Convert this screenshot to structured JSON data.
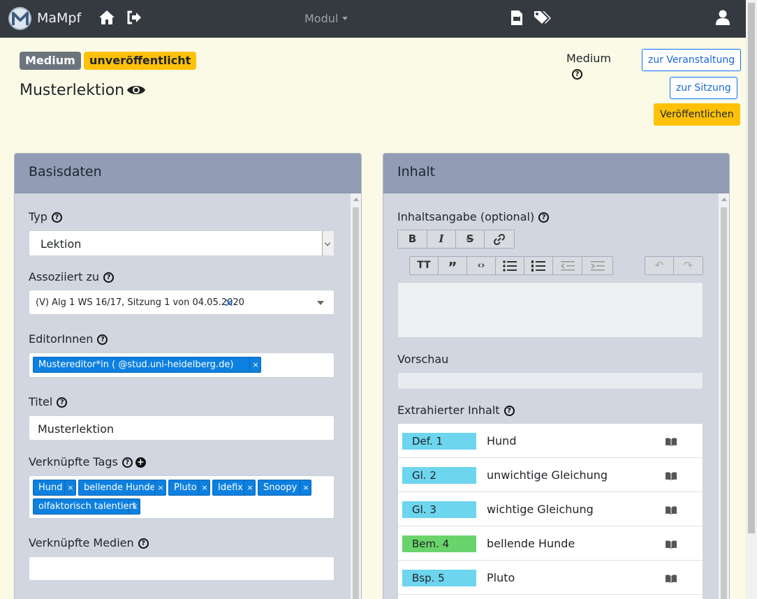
{
  "navbar": {
    "brand": "MaMpf",
    "modul_label": "Modul"
  },
  "header": {
    "badge_medium": "Medium",
    "badge_status": "unveröffentlicht",
    "title": "Musterlektion",
    "medium_label": "Medium",
    "btn_veranstaltung": "zur Veranstaltung",
    "btn_sitzung": "zur Sitzung",
    "btn_publish": "Veröffentlichen"
  },
  "basis": {
    "heading": "Basisdaten",
    "typ_label": "Typ",
    "typ_value": "Lektion",
    "assoc_label": "Assoziiert zu",
    "assoc_value": "(V) Alg 1 WS 16/17, Sitzung 1 von 04.05.2020",
    "editors_label": "EditorInnen",
    "editor_tag": "Mustereditor*in (            @stud.uni-heidelberg.de)",
    "title_label": "Titel",
    "title_value": "Musterlektion",
    "tags_label": "Verknüpfte Tags",
    "tags": [
      "Hund",
      "bellende Hunde",
      "Pluto",
      "Idefix",
      "Snoopy",
      "olfaktorisch talentiert"
    ],
    "media_label": "Verknüpfte Medien"
  },
  "inhalt": {
    "heading": "Inhalt",
    "summary_label": "Inhaltsangabe (optional)",
    "preview_label": "Vorschau",
    "extracted_label": "Extrahierter Inhalt",
    "items": [
      {
        "tag": "Def. 1",
        "text": "Hund",
        "color": "#6dd5ed"
      },
      {
        "tag": "Gl. 2",
        "text": "unwichtige Gleichung",
        "color": "#6dd5ed"
      },
      {
        "tag": "Gl. 3",
        "text": "wichtige Gleichung",
        "color": "#6dd5ed"
      },
      {
        "tag": "Bem. 4",
        "text": "bellende Hunde",
        "color": "#69d46b"
      },
      {
        "tag": "Bsp. 5",
        "text": "Pluto",
        "color": "#6dd5ed"
      }
    ]
  }
}
